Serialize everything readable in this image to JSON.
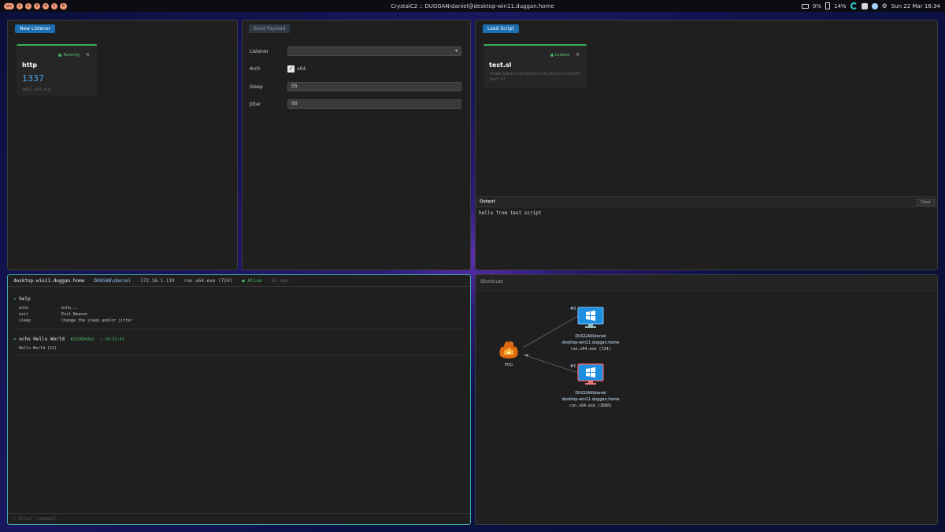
{
  "topbar": {
    "workspaces": [
      "ws",
      "1",
      "2",
      "3",
      "4",
      "5",
      "6"
    ],
    "window_title": "CrystalC2 :: DUGGAN\\daniel@desktop-win11.duggan.home",
    "tray": {
      "cpu": "0%",
      "battery": "14%",
      "datetime": "Sun 22 Mar 16:34"
    }
  },
  "listeners": {
    "new_button": "New Listener",
    "card": {
      "status": "Running",
      "close": "×",
      "name": "http",
      "port": "1337",
      "file": "sdc2.x64.zip"
    }
  },
  "payload": {
    "build_button": "Build Payload",
    "listener_label": "Listener",
    "listener_value": "",
    "arch_label": "Arch",
    "arch_option": "x64",
    "sleep_label": "Sleep",
    "sleep_value": "05",
    "jitter_label": "Jitter",
    "jitter_value": "00"
  },
  "scripts": {
    "load_button": "Load Script",
    "card": {
      "status": "Loaded",
      "close": "×",
      "name": "test.sl",
      "path": "/home/daniel/projects/crystalc2/client/test.sl"
    },
    "output_title": "Output",
    "clear_button": "Clear",
    "output_text": "hello from test script"
  },
  "console": {
    "host": "desktop-win11.duggan.home",
    "user": "DUGGAN\\daniel",
    "ip": "172.16.1.119",
    "process": "run.x64.exe (724)",
    "status": "● Alive",
    "last_seen": "3s ago",
    "entries": [
      {
        "prompt": "»",
        "command": "help"
      },
      {
        "prompt": "»",
        "command": "echo Hello World",
        "id": "#232894342",
        "check": "✓ 16:32:41"
      }
    ],
    "help": [
      {
        "cmd": "echo",
        "desc": "echo..."
      },
      {
        "cmd": "exit",
        "desc": "Exit Beacon"
      },
      {
        "cmd": "sleep",
        "desc": "Change the sleep and/or jitter"
      }
    ],
    "echo_output": "Hello World (12)",
    "input_placeholder": "» Enter command..."
  },
  "shortcuts": {
    "title": "Shortcuts",
    "listener_node": "http",
    "beacons": [
      {
        "index": "#0",
        "user": "DUGGAN\\daniel",
        "host": "desktop-win11.duggan.home",
        "proc": "run.x64.exe (724)"
      },
      {
        "index": "#1",
        "user": "DUGGAN\\daniel",
        "host": "desktop-win11.duggan.home",
        "proc": "run.x64.exe (3688)"
      }
    ]
  },
  "colors": {
    "accent": "#1b6fb3",
    "running": "#3cae5b",
    "console_border": "#3fa9a0",
    "link": "#4aa3e8"
  }
}
